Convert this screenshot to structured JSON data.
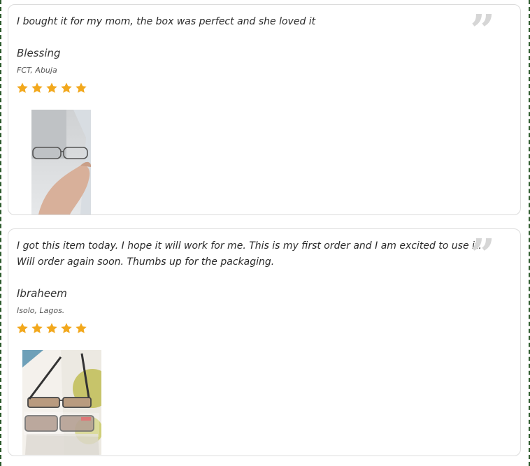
{
  "accent": {
    "star_color": "#f2a81d",
    "quote_icon_color": "#d6d6d6",
    "frame_border_color": "#2b5a2b"
  },
  "icons": {
    "quote": "quote-icon",
    "star": "star-icon",
    "photo": "glasses-photo"
  },
  "reviews": [
    {
      "text": "I bought it for my mom, the box was perfect and she loved it",
      "quote_glyph": "”",
      "name": "Blessing",
      "location": "FCT, Abuja",
      "rating": 5
    },
    {
      "text": "I got this item today. I hope it will work for me. This is my first order and I am excited to use it. Will order again soon. Thumbs up for the packaging.",
      "quote_glyph": "”",
      "name": "Ibraheem",
      "location": "Isolo, Lagos.",
      "rating": 5
    }
  ]
}
